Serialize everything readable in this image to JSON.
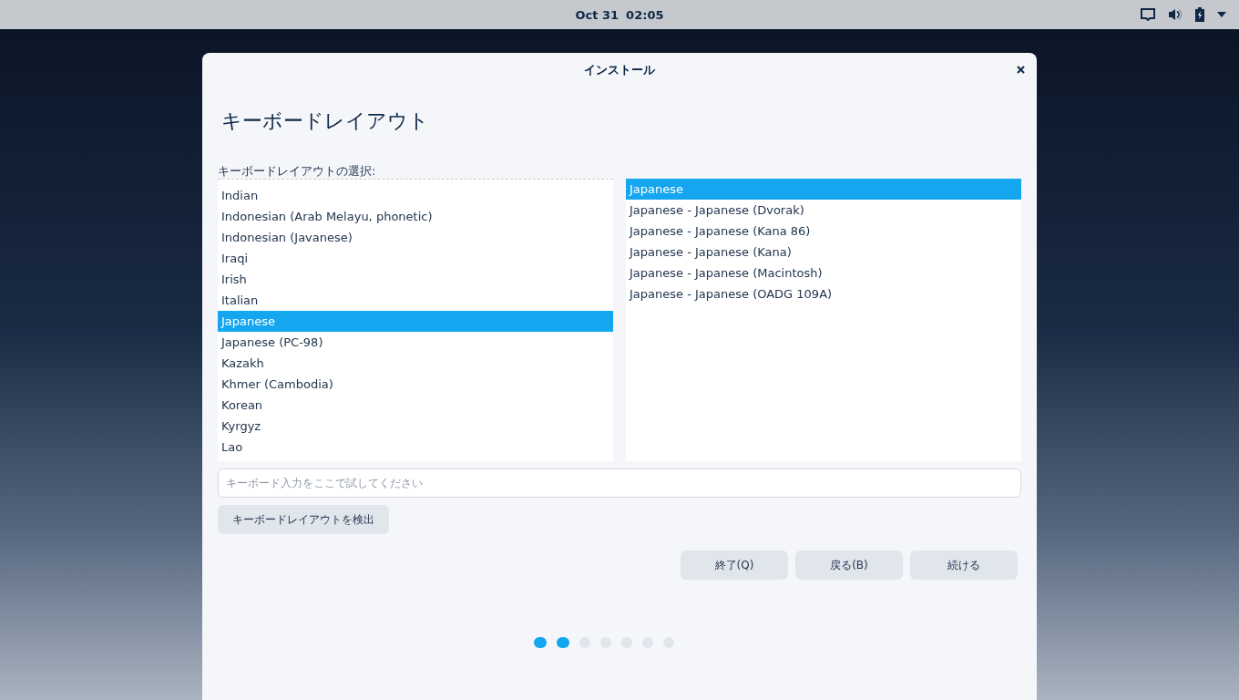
{
  "top_bar": {
    "date": "Oct 31",
    "time": "02:05"
  },
  "window": {
    "title": "インストール"
  },
  "heading": "キーボードレイアウト",
  "layout_label": "キーボードレイアウトの選択:",
  "layouts": [
    {
      "label": "Indian",
      "selected": false
    },
    {
      "label": "Indonesian (Arab Melayu, phonetic)",
      "selected": false
    },
    {
      "label": "Indonesian (Javanese)",
      "selected": false
    },
    {
      "label": "Iraqi",
      "selected": false
    },
    {
      "label": "Irish",
      "selected": false
    },
    {
      "label": "Italian",
      "selected": false
    },
    {
      "label": "Japanese",
      "selected": true
    },
    {
      "label": "Japanese (PC-98)",
      "selected": false
    },
    {
      "label": "Kazakh",
      "selected": false
    },
    {
      "label": "Khmer (Cambodia)",
      "selected": false
    },
    {
      "label": "Korean",
      "selected": false
    },
    {
      "label": "Kyrgyz",
      "selected": false
    },
    {
      "label": "Lao",
      "selected": false
    }
  ],
  "variants": [
    {
      "label": "Japanese",
      "selected": true
    },
    {
      "label": "Japanese - Japanese (Dvorak)",
      "selected": false
    },
    {
      "label": "Japanese - Japanese (Kana 86)",
      "selected": false
    },
    {
      "label": "Japanese - Japanese (Kana)",
      "selected": false
    },
    {
      "label": "Japanese - Japanese (Macintosh)",
      "selected": false
    },
    {
      "label": "Japanese - Japanese (OADG 109A)",
      "selected": false
    }
  ],
  "test_field": {
    "placeholder": "キーボード入力をここで試してください"
  },
  "detect_button": "キーボードレイアウトを検出",
  "buttons": [
    "終了(Q)",
    "戻る(B)",
    "続ける"
  ],
  "progress": [
    {
      "active": true
    },
    {
      "active": true
    },
    {
      "active": false
    },
    {
      "active": false
    },
    {
      "active": false
    },
    {
      "active": false
    },
    {
      "active": false
    }
  ]
}
